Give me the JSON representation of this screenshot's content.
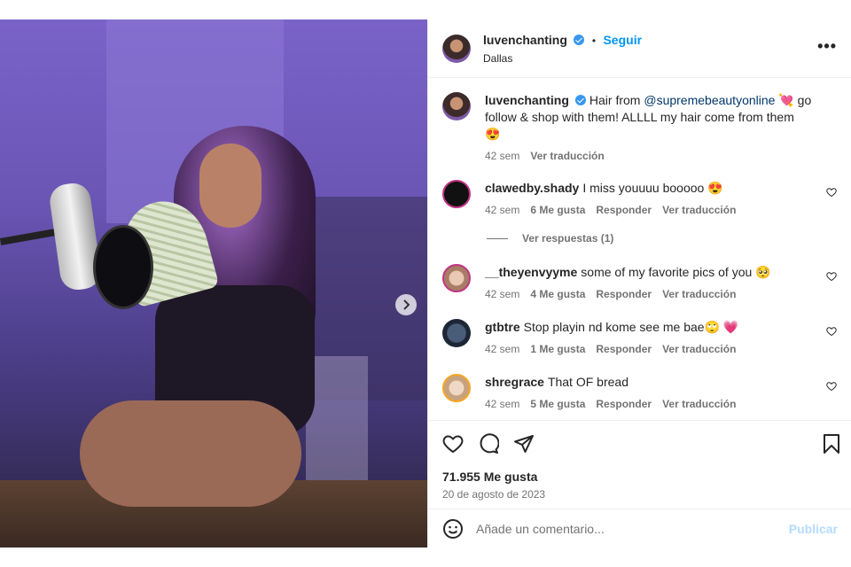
{
  "post": {
    "author": "luvenchanting",
    "follow_label": "Seguir",
    "separator": "•",
    "location": "Dallas",
    "more_label": "•••"
  },
  "caption": {
    "username": "luvenchanting",
    "text_before": "Hair from ",
    "mention": "@supremebeautyonline",
    "text_after": " 💘 go follow & shop with them! ALLLL my hair come from them 😍",
    "time": "42 sem",
    "translate": "Ver traducción"
  },
  "comments": [
    {
      "username": "clawedby.shady",
      "text": "I miss youuuu booooo 😍",
      "time": "42 sem",
      "likes": "6 Me gusta",
      "reply": "Responder",
      "translate": "Ver traducción"
    },
    {
      "username": "__theyenvyyme",
      "text": "some of my favorite pics of you 🥺",
      "time": "42 sem",
      "likes": "4 Me gusta",
      "reply": "Responder",
      "translate": "Ver traducción"
    },
    {
      "username": "gtbtre",
      "text": "Stop playin nd kome see me bae🙄 💗",
      "time": "42 sem",
      "likes": "1 Me gusta",
      "reply": "Responder",
      "translate": "Ver traducción"
    },
    {
      "username": "shregrace",
      "text": "That OF bread",
      "time": "42 sem",
      "likes": "5 Me gusta",
      "reply": "Responder",
      "translate": "Ver traducción"
    }
  ],
  "view_replies": "Ver respuestas (1)",
  "likes_count": "71.955 Me gusta",
  "date": "20 de agosto de 2023",
  "add_comment": {
    "placeholder": "Añade un comentario...",
    "publish_label": "Publicar"
  },
  "icons": {
    "like": "heart-icon",
    "comment": "comment-icon",
    "share": "send-icon",
    "save": "bookmark-icon",
    "emoji": "emoji-icon",
    "next": "chevron-right-icon",
    "more": "more-icon",
    "verified": "verified-badge-icon"
  },
  "carousel": {
    "count": 2,
    "active": 1
  },
  "colors": {
    "accent": "#0095f6",
    "verified": "#3897f0",
    "mention": "#00376b",
    "publish_disabled": "#b3dbff"
  }
}
